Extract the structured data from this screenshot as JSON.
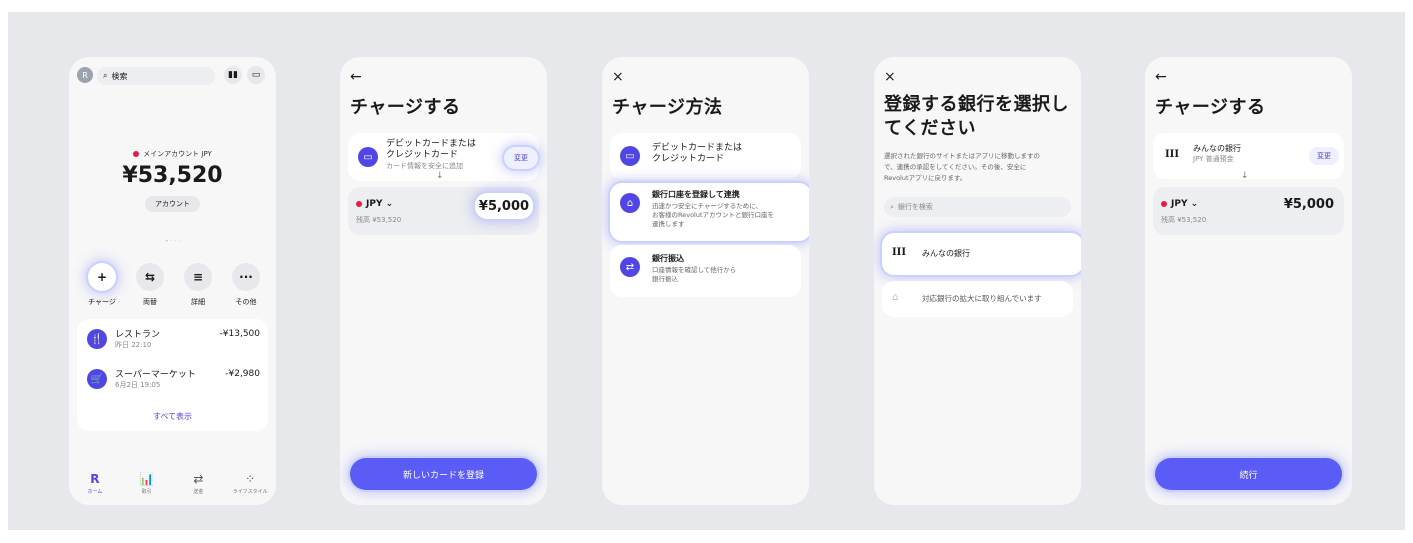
{
  "screen1": {
    "avatar": "R",
    "search_placeholder": "検索",
    "account_label": "メインアカウント JPY",
    "balance": "¥53,520",
    "account_button": "アカウント",
    "actions": [
      {
        "label": "チャージ",
        "glyph": "+"
      },
      {
        "label": "両替",
        "glyph": "⇆"
      },
      {
        "label": "詳細",
        "glyph": "≡"
      },
      {
        "label": "その他",
        "glyph": "···"
      }
    ],
    "transactions": [
      {
        "name": "レストラン",
        "time": "昨日 22:10",
        "amount": "-¥13,500",
        "icon": "fork-knife-icon",
        "glyph": "🍴"
      },
      {
        "name": "スーパーマーケット",
        "time": "6月2日 19:05",
        "amount": "-¥2,980",
        "icon": "basket-icon",
        "glyph": "🛒"
      }
    ],
    "show_all": "すべて表示",
    "tabs": [
      {
        "label": "ホーム",
        "glyph": "R"
      },
      {
        "label": "取引",
        "glyph": "📊"
      },
      {
        "label": "送金",
        "glyph": "⇄"
      },
      {
        "label": "ライフスタイル",
        "glyph": "⁘"
      }
    ]
  },
  "screen2": {
    "back": "←",
    "title": "チャージする",
    "card_title": "デビットカードまたは\nクレジットカード",
    "card_sub": "カード情報を安全に追加",
    "change": "変更",
    "currency": "JPY ⌄",
    "balance_sub": "残高 ¥53,520",
    "amount": "¥5,000",
    "cta": "新しいカードを登録"
  },
  "screen3": {
    "close": "×",
    "title": "チャージ方法",
    "options": [
      {
        "title": "デビットカードまたは\nクレジットカード",
        "desc": "",
        "icon": "card-icon"
      },
      {
        "title": "銀行口座を登録して連携",
        "desc": "迅速かつ安全にチャージするために、\nお客様のRevolutアカウントと銀行口座を\n連携します",
        "icon": "bank-icon"
      },
      {
        "title": "銀行振込",
        "desc": "口座情報を確認して他行から\n銀行振込",
        "icon": "transfer-icon"
      }
    ]
  },
  "screen4": {
    "close": "×",
    "title": "登録する銀行を選択し\nてください",
    "desc": "選択された銀行のサイトまたはアプリに移動しますの\nで、連携の承認をしてください。その後、安全に\nRevolutアプリに戻ります。",
    "search_placeholder": "銀行を検索",
    "bank_mark": "III",
    "bank": "みんなの銀行",
    "expanding": "対応銀行の拡大に取り組んでいます"
  },
  "screen5": {
    "back": "←",
    "title": "チャージする",
    "bank_mark": "III",
    "bank": "みんなの銀行",
    "bank_sub": "JPY 普通預金",
    "change": "変更",
    "currency": "JPY ⌄",
    "balance_sub": "残高 ¥53,520",
    "amount": "¥5,000",
    "cta": "続行"
  }
}
